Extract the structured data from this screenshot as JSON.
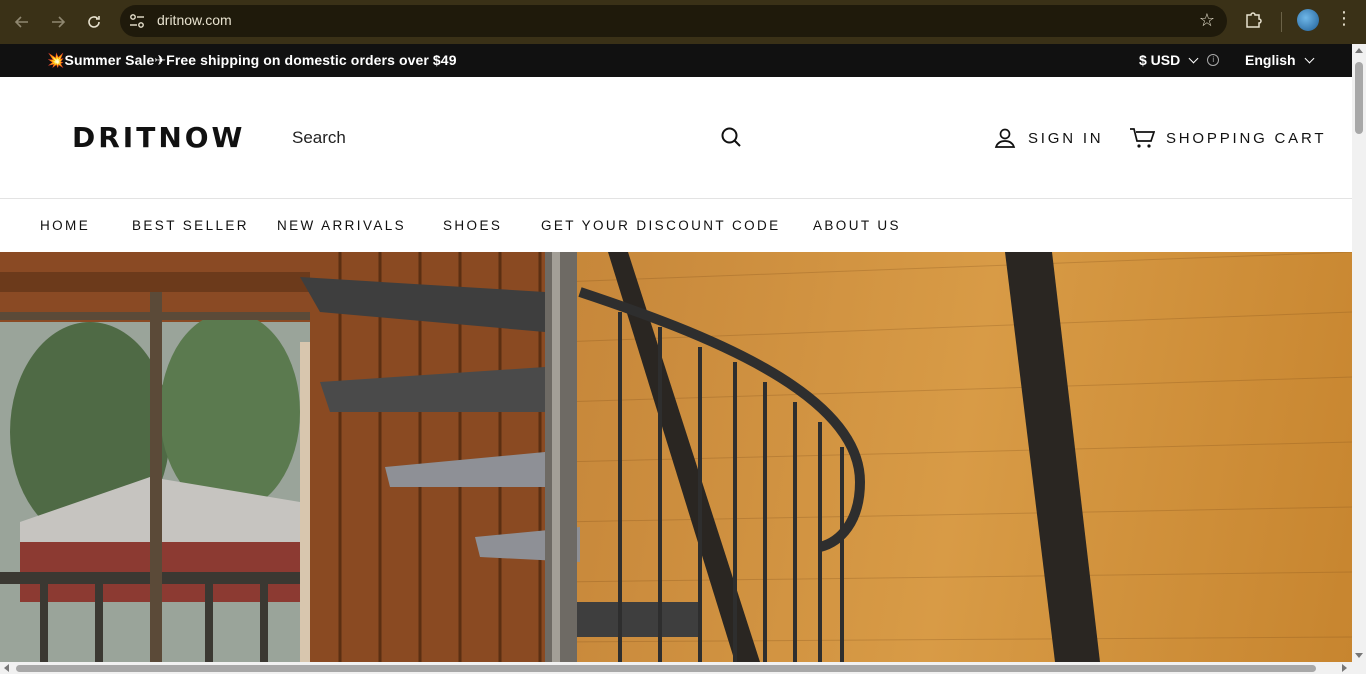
{
  "browser": {
    "url": "dritnow.com",
    "icons": {
      "back": "back-arrow-icon",
      "forward": "forward-arrow-icon",
      "reload": "reload-icon",
      "site_info": "tune-icon",
      "bookmark": "star-icon",
      "extensions": "puzzle-icon",
      "profile": "avatar",
      "menu": "kebab-menu-icon"
    },
    "colors": {
      "frame": "#3a3117",
      "omnibox": "#1f1a0b"
    }
  },
  "announcement": {
    "message": "💥Summer Sale✈Free shipping on domestic orders over $49",
    "currency": "$ USD",
    "language": "English",
    "background": "#111111"
  },
  "header": {
    "logo": "DRITNOW",
    "search_placeholder": "Search",
    "sign_in": "SIGN IN",
    "cart": "SHOPPING CART"
  },
  "nav": {
    "items": [
      {
        "label": "HOME"
      },
      {
        "label": "BEST SELLER"
      },
      {
        "label": "NEW ARRIVALS"
      },
      {
        "label": "SHOES"
      },
      {
        "label": "GET YOUR DISCOUNT CODE"
      },
      {
        "label": "ABOUT US"
      }
    ]
  },
  "hero": {
    "image": "spiral-staircase-cabin-photo"
  }
}
